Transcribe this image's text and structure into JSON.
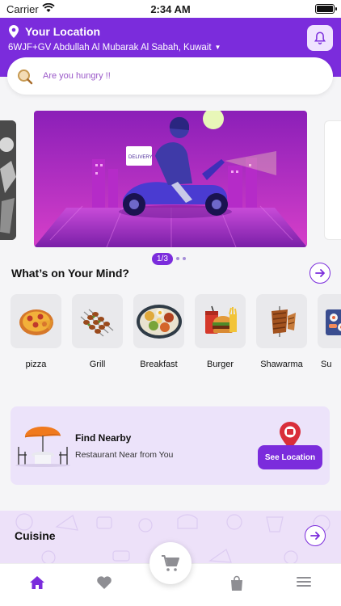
{
  "status_bar": {
    "carrier": "Carrier",
    "time": "2:34 AM"
  },
  "header": {
    "location_title": "Your Location",
    "address": "6WJF+GV Abdullah Al Mubarak Al Sabah, Kuwait"
  },
  "search": {
    "placeholder": "Are you hungry !!"
  },
  "carousel": {
    "indicator": "1/3",
    "current": 1,
    "total": 3,
    "slide_badge": "DELIVERY"
  },
  "mind_section": {
    "title": "What’s on Your Mind?",
    "categories": [
      {
        "label": "pizza",
        "icon": "pizza-icon"
      },
      {
        "label": "Grill",
        "icon": "grill-icon"
      },
      {
        "label": "Breakfast",
        "icon": "breakfast-icon"
      },
      {
        "label": "Burger",
        "icon": "burger-icon"
      },
      {
        "label": "Shawarma",
        "icon": "shawarma-icon"
      },
      {
        "label": "Su",
        "icon": "sushi-icon"
      }
    ]
  },
  "nearby": {
    "title": "Find Nearby",
    "subtitle": "Restaurant Near from You",
    "button": "See Location"
  },
  "cuisine": {
    "title": "Cuisine"
  },
  "bottom_nav": {
    "items": [
      {
        "icon": "home-icon",
        "active": true
      },
      {
        "icon": "heart-icon",
        "active": false
      },
      {
        "icon": "cart-icon",
        "active": false
      },
      {
        "icon": "bag-icon",
        "active": false
      },
      {
        "icon": "menu-icon",
        "active": false
      }
    ]
  },
  "colors": {
    "accent": "#7b2cdc",
    "accent_light": "#ece3fa",
    "background": "#f5f5f7"
  }
}
